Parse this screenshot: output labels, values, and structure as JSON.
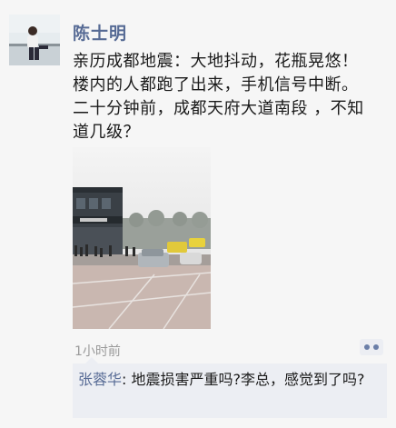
{
  "post": {
    "author": "陈士明",
    "text_lines": [
      "亲历成都地震：大地抖动，花瓶晃悠！",
      "楼内的人都跑了出来，手机信号中断。",
      "二十分钟前，成都天府大道南段 ，不知",
      "道几级？"
    ],
    "time": "1小时前",
    "comment_icon": "comment-dots-icon"
  },
  "comments": [
    {
      "name": "张蓉华",
      "separator": ": ",
      "text": "地震损害严重吗?李总，感觉到了吗?"
    }
  ],
  "colors": {
    "name_link": "#576b95",
    "comment_bg": "#eceef3",
    "page_bg": "#f6f6f6"
  }
}
